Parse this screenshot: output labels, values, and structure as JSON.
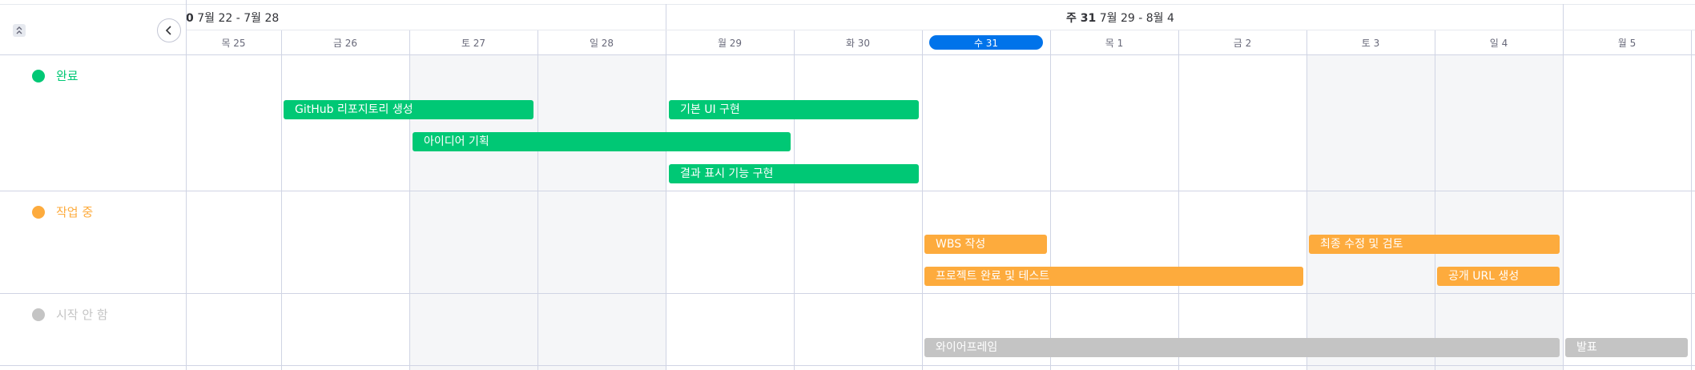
{
  "colors": {
    "done": "#00c875",
    "working": "#fdab3d",
    "not_started": "#c4c4c4",
    "accent": "#0073ea",
    "weekend": "#f5f6f8"
  },
  "header": {
    "week1": {
      "prefix": "0",
      "range": "7월 22 - 7월 28"
    },
    "week2": {
      "prefix": "주 31",
      "range": "7월 29 - 8월 4"
    }
  },
  "days": [
    {
      "label": "목 25"
    },
    {
      "label": "금 26"
    },
    {
      "label": "토 27",
      "weekend": true
    },
    {
      "label": "일 28",
      "weekend": true
    },
    {
      "label": "월 29"
    },
    {
      "label": "화 30"
    },
    {
      "label": "수 31",
      "today": true
    },
    {
      "label": "목 1"
    },
    {
      "label": "금 2"
    },
    {
      "label": "토 3",
      "weekend": true
    },
    {
      "label": "일 4",
      "weekend": true
    },
    {
      "label": "월 5"
    }
  ],
  "groups": [
    {
      "name": "완료",
      "status": "done"
    },
    {
      "name": "작업 중",
      "status": "working"
    },
    {
      "name": "시작 안 함",
      "status": "not_started"
    }
  ],
  "tasks": [
    {
      "name": "GitHub 리포지토리 생성",
      "group": "done",
      "start": "7월 26",
      "end": "7월 28"
    },
    {
      "name": "기본 UI 구현",
      "group": "done",
      "start": "7월 29",
      "end": "7월 30"
    },
    {
      "name": "아이디어 기획",
      "group": "done",
      "start": "7월 27",
      "end": "7월 29"
    },
    {
      "name": "결과 표시 기능 구현",
      "group": "done",
      "start": "7월 29",
      "end": "7월 30"
    },
    {
      "name": "WBS 작성",
      "group": "working",
      "start": "7월 31",
      "end": "7월 31"
    },
    {
      "name": "최종 수정 및 검토",
      "group": "working",
      "start": "8월 3",
      "end": "8월 4"
    },
    {
      "name": "프로젝트 완료 및 테스트",
      "group": "working",
      "start": "7월 31",
      "end": "8월 2"
    },
    {
      "name": "공개 URL 생성",
      "group": "working",
      "start": "8월 4",
      "end": "8월 4"
    },
    {
      "name": "와이어프레임",
      "group": "not_started",
      "start": "7월 31",
      "end": "8월 4"
    },
    {
      "name": "발표",
      "group": "not_started",
      "start": "8월 5",
      "end": "8월 5"
    }
  ]
}
